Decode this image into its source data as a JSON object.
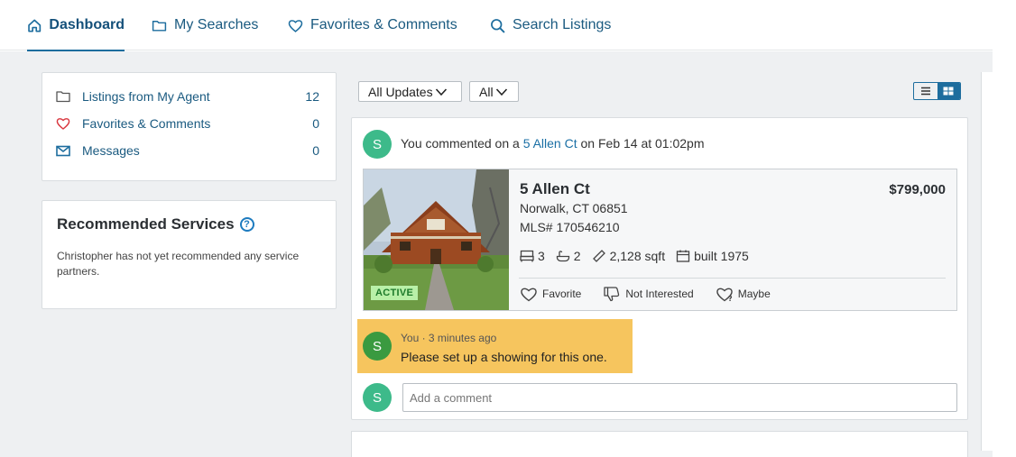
{
  "nav": {
    "tabs": [
      {
        "label": "Dashboard",
        "icon": "home-icon",
        "active": true
      },
      {
        "label": "My Searches",
        "icon": "folder-icon",
        "active": false
      },
      {
        "label": "Favorites & Comments",
        "icon": "heart-icon",
        "active": false
      },
      {
        "label": "Search Listings",
        "icon": "search-icon",
        "active": false
      }
    ]
  },
  "summary": {
    "items": [
      {
        "label": "Listings from My Agent",
        "count": "12",
        "icon": "folder-icon"
      },
      {
        "label": "Favorites & Comments",
        "count": "0",
        "icon": "heart-icon"
      },
      {
        "label": "Messages",
        "count": "0",
        "icon": "envelope-icon"
      }
    ]
  },
  "recommended": {
    "title": "Recommended Services",
    "help": "?",
    "text": "Christopher has not yet recommended any service partners."
  },
  "filters": {
    "updates": "All Updates",
    "scope": "All"
  },
  "feed": {
    "avatar_initial": "S",
    "activity": {
      "prefix": "You commented on a",
      "link": "5 Allen Ct",
      "suffix": "on Feb 14 at 01:02pm"
    },
    "listing": {
      "address": "5 Allen Ct",
      "price": "$799,000",
      "city": "Norwalk, CT 06851",
      "mls": "MLS# 170546210",
      "status": "ACTIVE",
      "beds": "3",
      "baths": "2",
      "sqft": "2,128 sqft",
      "built": "built 1975",
      "actions": {
        "favorite": "Favorite",
        "not_interested": "Not Interested",
        "maybe": "Maybe"
      }
    },
    "comment": {
      "avatar_initial": "S",
      "meta": "You · 3 minutes ago",
      "text": "Please set up a showing for this one."
    },
    "comment_input": {
      "avatar_initial": "S",
      "placeholder": "Add a comment"
    }
  },
  "colors": {
    "brand": "#1d6d9e",
    "avatar": "#3dba8a",
    "comment_highlight": "#f6c55e",
    "active_badge": "#b9f0a8"
  }
}
